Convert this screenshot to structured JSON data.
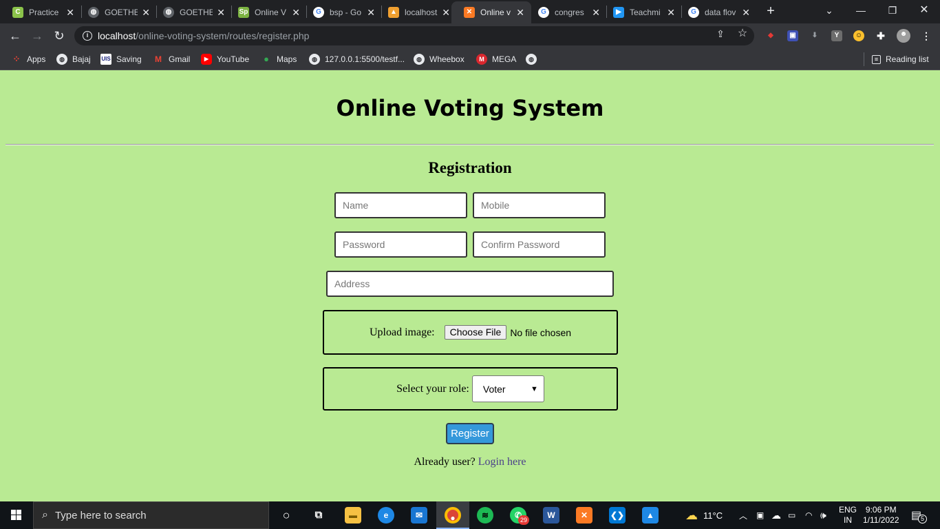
{
  "browser": {
    "tabs": [
      {
        "title": "Practice",
        "favicon": "practice-icon",
        "color": "#8bc34a"
      },
      {
        "title": "GOETHE",
        "favicon": "globe-icon",
        "color": "#5f6368"
      },
      {
        "title": "GOETHE",
        "favicon": "globe-icon",
        "color": "#5f6368"
      },
      {
        "title": "Online V",
        "favicon": "sp-icon",
        "color": "#7cb342"
      },
      {
        "title": "bsp - Go",
        "favicon": "google-icon",
        "color": "#4285f4"
      },
      {
        "title": "localhost",
        "favicon": "phpmyadmin-icon",
        "color": "#f0a030"
      },
      {
        "title": "Online v",
        "favicon": "xampp-icon",
        "color": "#fb7a24",
        "active": true
      },
      {
        "title": "congres",
        "favicon": "google-icon",
        "color": "#4285f4"
      },
      {
        "title": "Teachmi",
        "favicon": "teachmint-icon",
        "color": "#2196f3"
      },
      {
        "title": "data flov",
        "favicon": "google-icon",
        "color": "#4285f4"
      }
    ],
    "address": {
      "host": "localhost",
      "path": "/online-voting-system/routes/register.php"
    },
    "bookmarks": [
      {
        "label": "Apps",
        "icon": "apps-grid-icon"
      },
      {
        "label": "Bajaj",
        "icon": "globe-icon"
      },
      {
        "label": "Saving",
        "icon": "saving-icon"
      },
      {
        "label": "Gmail",
        "icon": "gmail-icon"
      },
      {
        "label": "YouTube",
        "icon": "youtube-icon"
      },
      {
        "label": "Maps",
        "icon": "maps-icon"
      },
      {
        "label": "127.0.0.1:5500/testf...",
        "icon": "globe-icon"
      },
      {
        "label": "Wheebox",
        "icon": "globe-icon"
      },
      {
        "label": "MEGA",
        "icon": "mega-icon"
      },
      {
        "label": "",
        "icon": "globe-icon"
      }
    ],
    "reading_list": "Reading list"
  },
  "page": {
    "title": "Online Voting System",
    "subtitle": "Registration",
    "fields": {
      "name_placeholder": "Name",
      "mobile_placeholder": "Mobile",
      "password_placeholder": "Password",
      "confirm_placeholder": "Confirm Password",
      "address_placeholder": "Address"
    },
    "upload": {
      "label": "Upload image:",
      "button": "Choose File",
      "status": "No file chosen"
    },
    "role": {
      "label": "Select your role:",
      "selected": "Voter"
    },
    "register_button": "Register",
    "login_prompt": "Already user?",
    "login_link": "Login here"
  },
  "taskbar": {
    "search_placeholder": "Type here to search",
    "weather": "11°C",
    "language": "ENG",
    "region": "IN",
    "time": "9:06 PM",
    "date": "1/11/2022",
    "whatsapp_badge": "29",
    "notification_count": "5"
  }
}
